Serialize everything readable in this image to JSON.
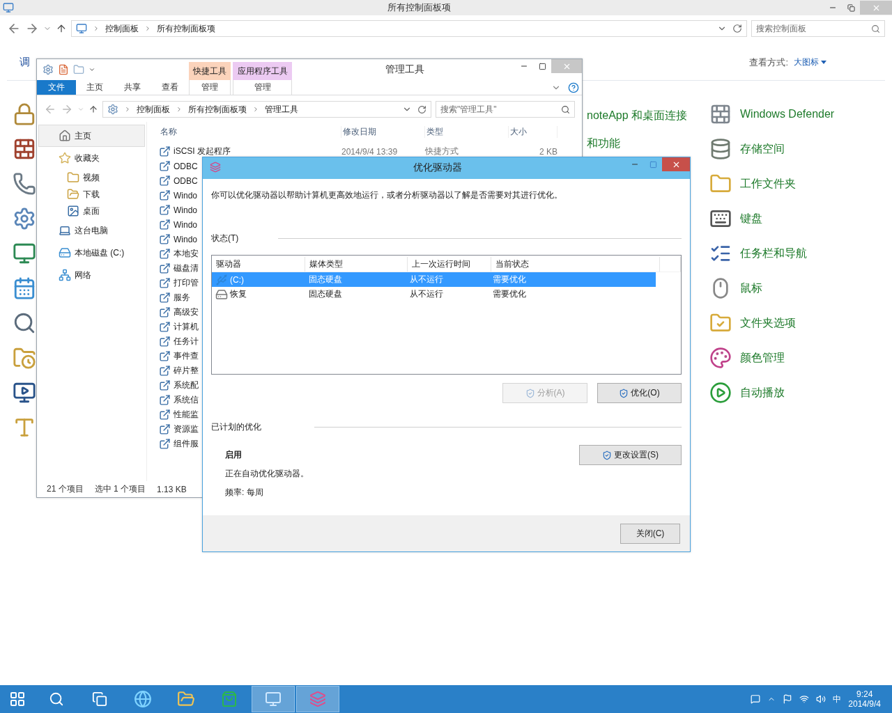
{
  "control_panel": {
    "title": "所有控制面板项",
    "breadcrumb": [
      "控制面板",
      "所有控制面板项"
    ],
    "search": {
      "placeholder": "搜索控制面板"
    },
    "heading": "调",
    "view_label": "查看方式:",
    "view_value": "大图标",
    "middle_items": [
      "noteApp 和桌面连接",
      "和功能"
    ],
    "items": [
      "Windows Defender",
      "存储空间",
      "工作文件夹",
      "键盘",
      "任务栏和导航",
      "鼠标",
      "文件夹选项",
      "颜色管理",
      "自动播放"
    ]
  },
  "explorer": {
    "title": "管理工具",
    "context_tabs": [
      {
        "label": "快捷工具",
        "color": "#fbd3bb"
      },
      {
        "label": "应用程序工具",
        "color": "#eccaf2"
      }
    ],
    "ribbon_tabs": [
      {
        "label": "文件",
        "kind": "file"
      },
      {
        "label": "主页",
        "kind": "tab"
      },
      {
        "label": "共享",
        "kind": "tab"
      },
      {
        "label": "查看",
        "kind": "tab"
      },
      {
        "label": "管理",
        "kind": "context"
      },
      {
        "label": "管理",
        "kind": "context"
      }
    ],
    "breadcrumb": [
      "控制面板",
      "所有控制面板项",
      "管理工具"
    ],
    "search": {
      "placeholder": "搜索\"管理工具\""
    },
    "nav": [
      {
        "label": "主页",
        "kind": "home",
        "selected": true
      },
      {
        "label": "收藏夹",
        "kind": "favorites",
        "selected": false,
        "children": [
          {
            "label": "视频",
            "kind": "videos",
            "selected": false
          },
          {
            "label": "下载",
            "kind": "downloads",
            "selected": false
          },
          {
            "label": "桌面",
            "kind": "desktop",
            "selected": false
          }
        ]
      },
      {
        "label": "这台电脑",
        "kind": "pc",
        "selected": false
      },
      {
        "label": "本地磁盘 (C:)",
        "kind": "disk",
        "selected": false
      },
      {
        "label": "网络",
        "kind": "network",
        "selected": false
      }
    ],
    "columns": [
      "名称",
      "修改日期",
      "类型",
      "大小"
    ],
    "rows": [
      {
        "name": "iSCSI 发起程序",
        "date": "2014/9/4 13:39",
        "type": "快捷方式",
        "size": "2 KB"
      },
      {
        "name": "ODBC"
      },
      {
        "name": "ODBC"
      },
      {
        "name": "Windo"
      },
      {
        "name": "Windo"
      },
      {
        "name": "Windo"
      },
      {
        "name": "Windo"
      },
      {
        "name": "本地安"
      },
      {
        "name": "磁盘清"
      },
      {
        "name": "打印管"
      },
      {
        "name": "服务"
      },
      {
        "name": "高级安"
      },
      {
        "name": "计算机"
      },
      {
        "name": "任务计"
      },
      {
        "name": "事件查"
      },
      {
        "name": "碎片整"
      },
      {
        "name": "系统配"
      },
      {
        "name": "系统信"
      },
      {
        "name": "性能监"
      },
      {
        "name": "资源监"
      },
      {
        "name": "组件服"
      }
    ],
    "status": [
      "21 个项目",
      "选中 1 个项目",
      "1.13 KB"
    ]
  },
  "dialog": {
    "title": "优化驱动器",
    "description": "你可以优化驱动器以帮助计算机更高效地运行，或者分析驱动器以了解是否需要对其进行优化。",
    "status_label": "状态(T)",
    "columns": [
      "驱动器",
      "媒体类型",
      "上一次运行时间",
      "当前状态"
    ],
    "drives": [
      {
        "name": "(C:)",
        "kind": "system",
        "media": "固态硬盘",
        "last_run": "从不运行",
        "state": "需要优化",
        "selected": true
      },
      {
        "name": "恢复",
        "kind": "volume",
        "media": "固态硬盘",
        "last_run": "从不运行",
        "state": "需要优化",
        "selected": false
      }
    ],
    "buttons": [
      {
        "label": "分析(A)",
        "disabled": true
      },
      {
        "label": "优化(O)",
        "disabled": false
      }
    ],
    "schedule_label": "已计划的优化",
    "schedule_status": "启用",
    "schedule_text": "正在自动优化驱动器。",
    "frequency": "频率: 每周",
    "settings_button": "更改设置(S)",
    "close_button": "关闭(C)"
  },
  "taskbar": {
    "apps": [
      {
        "kind": "start",
        "active": false
      },
      {
        "kind": "search",
        "active": false
      },
      {
        "kind": "taskview",
        "active": false
      },
      {
        "kind": "ie",
        "active": false
      },
      {
        "kind": "explorer",
        "active": false
      },
      {
        "kind": "store",
        "active": false
      },
      {
        "kind": "control-panel",
        "active": true
      },
      {
        "kind": "defrag",
        "active": true
      }
    ],
    "ime": "中",
    "time": "9:24",
    "date": "2014/9/4"
  }
}
